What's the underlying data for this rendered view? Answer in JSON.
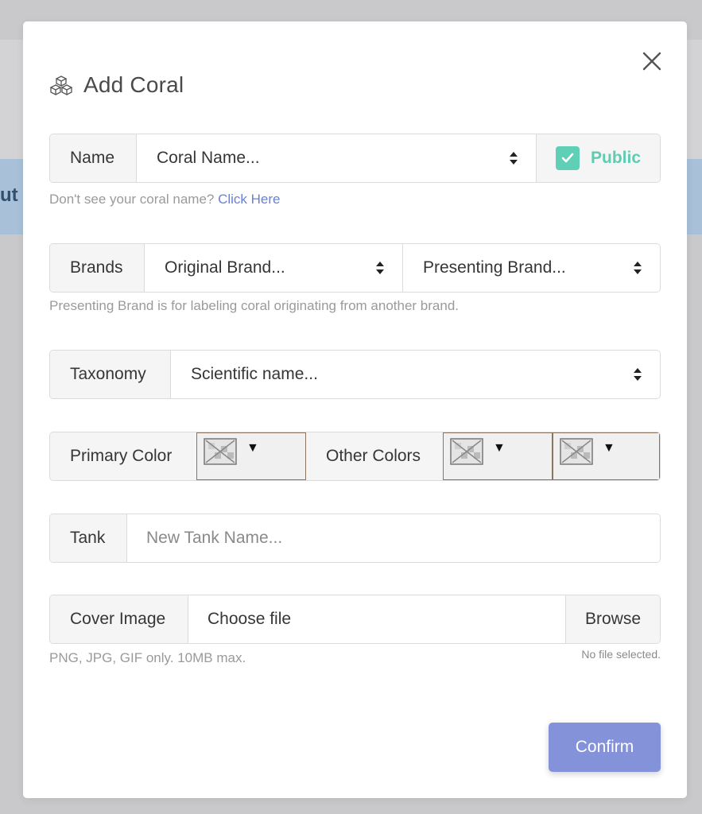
{
  "background": {
    "banner_text": "ut"
  },
  "modal": {
    "title": "Add Coral",
    "icon": "cubes-icon",
    "close_icon": "close-icon"
  },
  "name_row": {
    "label": "Name",
    "select_value": "Coral Name...",
    "public_label": "Public",
    "public_checked": true,
    "help_text": "Don't see your coral name?",
    "help_link": "Click Here"
  },
  "brands_row": {
    "label": "Brands",
    "original_value": "Original Brand...",
    "presenting_value": "Presenting Brand...",
    "help_text": "Presenting Brand is for labeling coral originating from another brand."
  },
  "taxonomy_row": {
    "label": "Taxonomy",
    "select_value": "Scientific name..."
  },
  "colors_row": {
    "primary_label": "Primary Color",
    "other_label": "Other Colors",
    "caret": "▼"
  },
  "tank_row": {
    "label": "Tank",
    "placeholder": "New Tank Name..."
  },
  "cover_row": {
    "label": "Cover Image",
    "file_label": "Choose file",
    "browse_label": "Browse",
    "help_text": "PNG, JPG, GIF only. 10MB max.",
    "no_file_text": "No file selected."
  },
  "confirm_label": "Confirm",
  "colors": {
    "accent": "#8492d9",
    "public_green": "#5fcbb0",
    "link": "#6b7fd7"
  }
}
